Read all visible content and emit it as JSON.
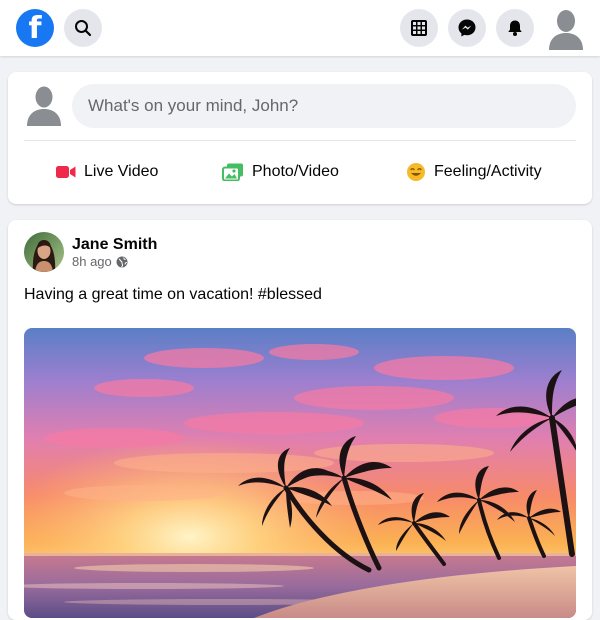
{
  "header": {
    "logo_letter": "f",
    "icons": [
      "facebook-logo",
      "search-icon",
      "apps-grid-icon",
      "messenger-icon",
      "bell-icon",
      "profile-avatar-icon"
    ]
  },
  "composer": {
    "placeholder": "What's on your mind, John?",
    "actions": [
      {
        "label": "Live Video",
        "icon": "video-camera-icon",
        "color": "#f02849"
      },
      {
        "label": "Photo/Video",
        "icon": "photo-icon",
        "color": "#45bd62"
      },
      {
        "label": "Feeling/Activity",
        "icon": "smiley-icon",
        "color": "#f7b928"
      }
    ]
  },
  "post": {
    "author": "Jane Smith",
    "time": "8h ago",
    "privacy_icon": "globe-icon",
    "text": "Having a great time on vacation! #blessed",
    "image": "sunset-beach-palms"
  },
  "colors": {
    "brand": "#1877f2",
    "background": "#f0f2f5",
    "secondary_text": "#65676b"
  }
}
